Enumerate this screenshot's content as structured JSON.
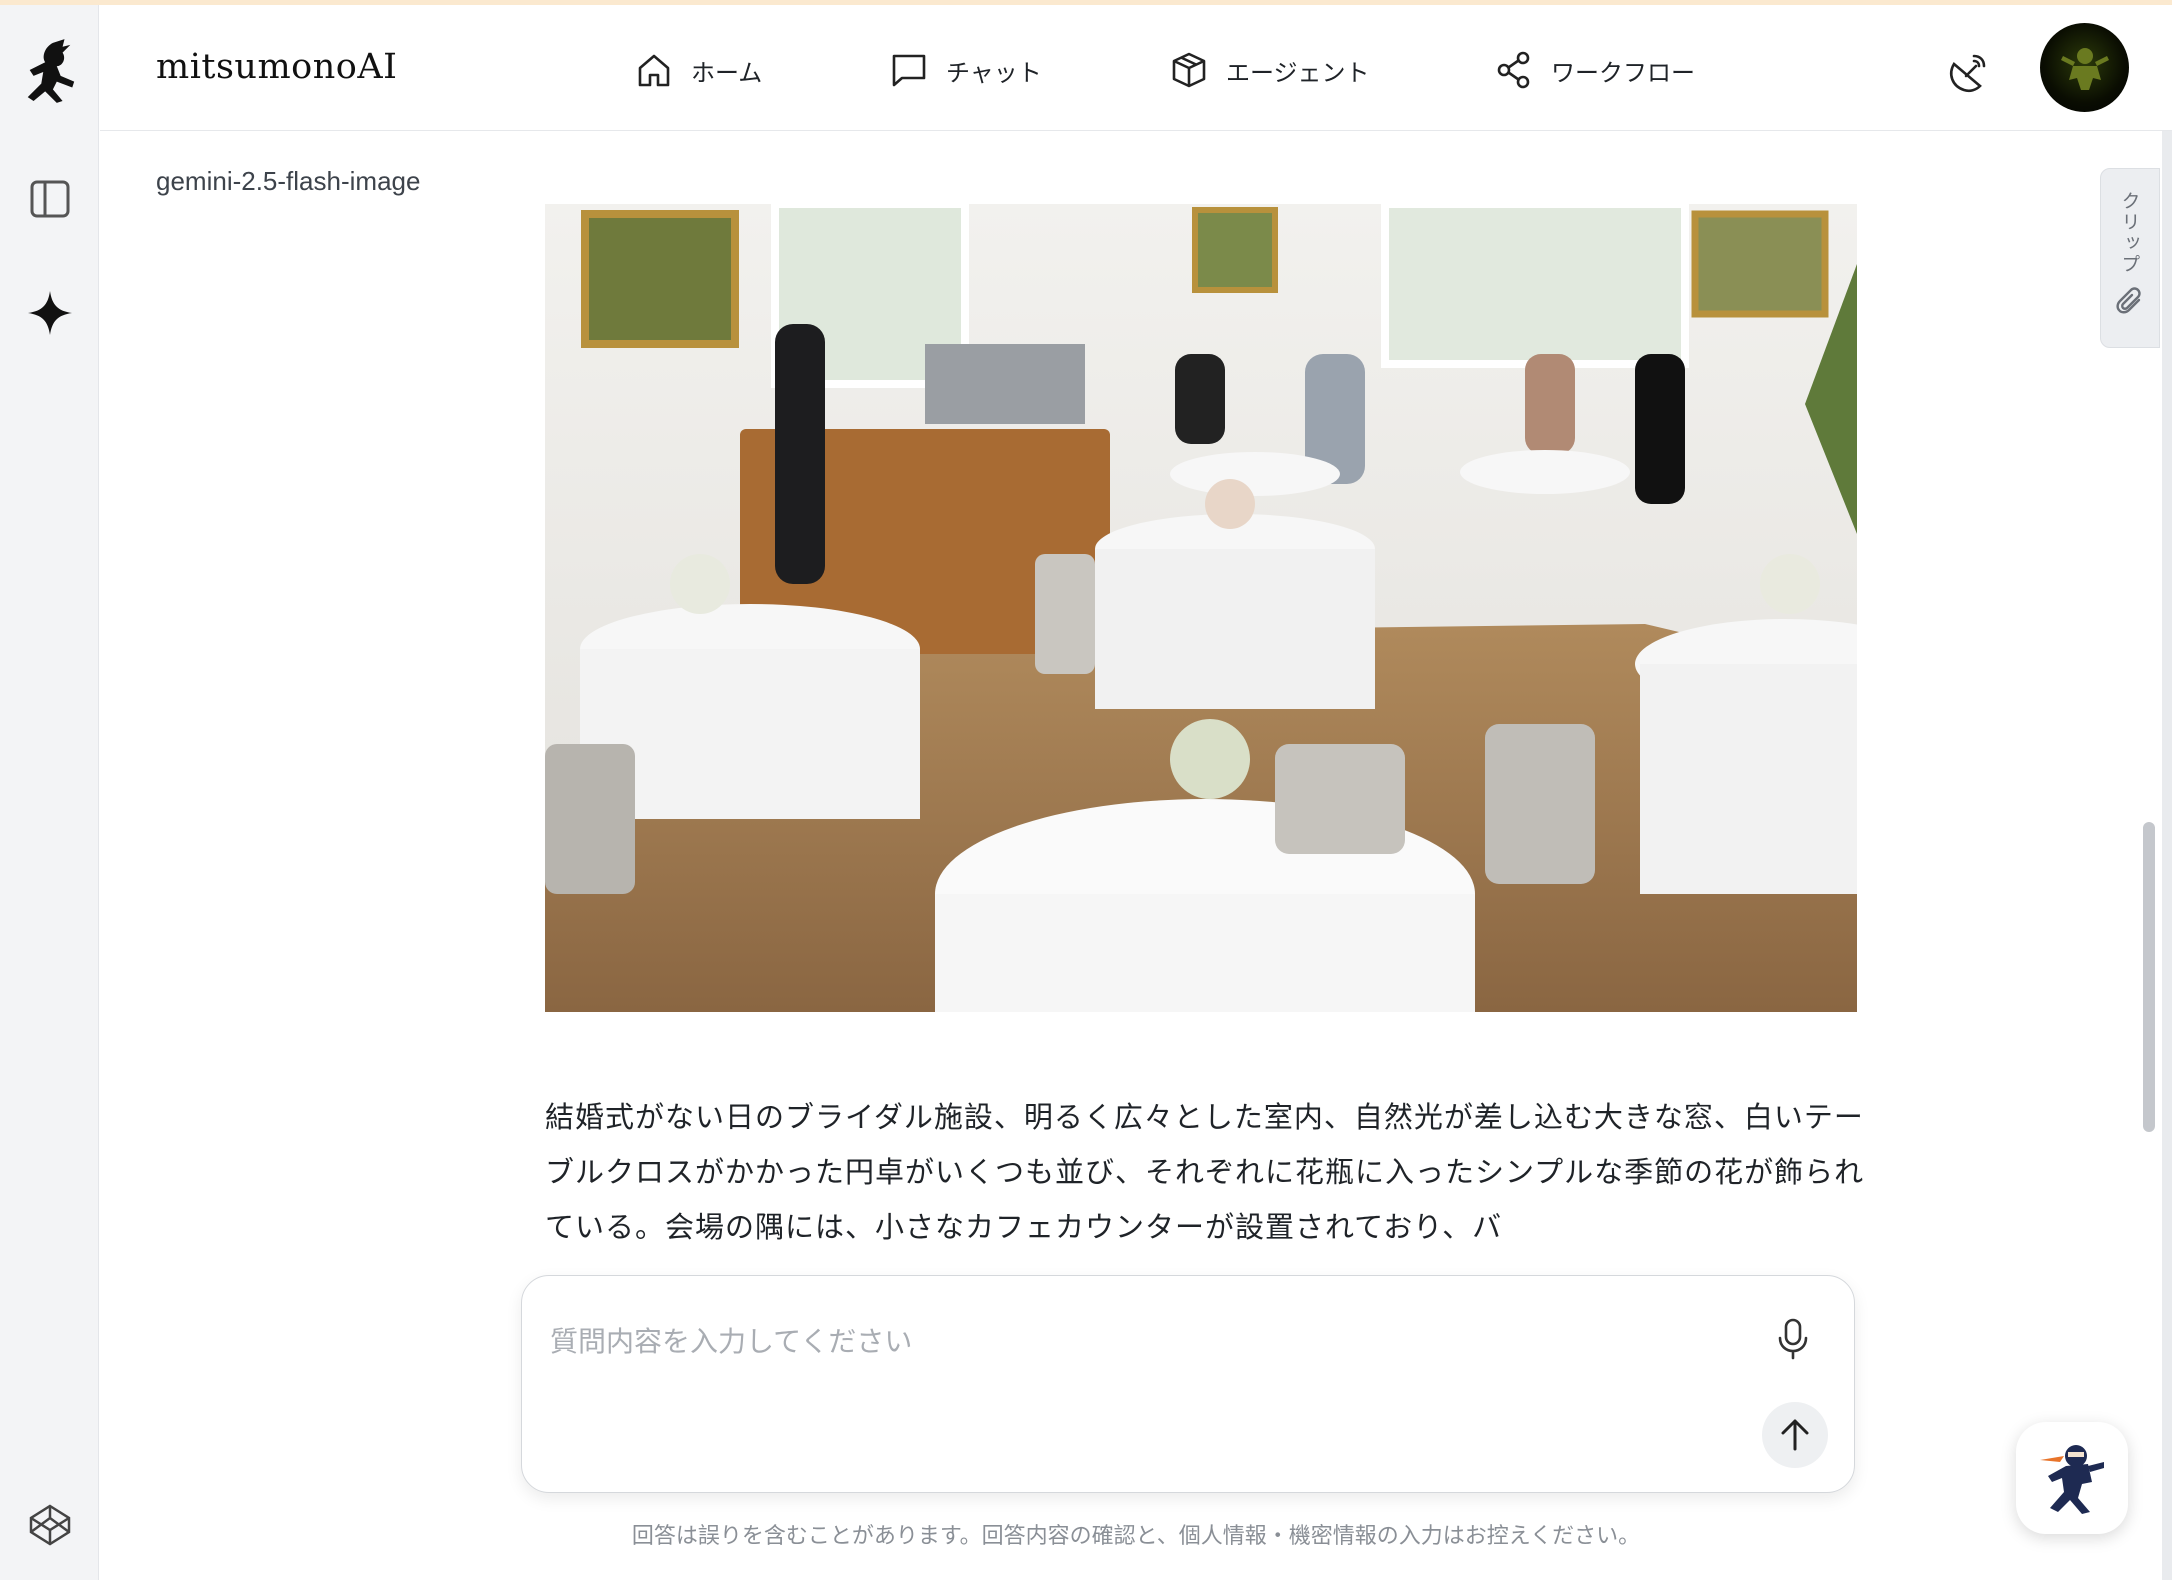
{
  "app": {
    "brand": "mitsumonoAI"
  },
  "nav": [
    {
      "label": "ホーム",
      "icon": "home-icon"
    },
    {
      "label": "チャット",
      "icon": "chat-icon"
    },
    {
      "label": "エージェント",
      "icon": "cube-icon"
    },
    {
      "label": "ワークフロー",
      "icon": "share-nodes-icon"
    }
  ],
  "message": {
    "model": "gemini-2.5-flash-image",
    "image_alt": "generated image of a bright bridal venue with round white-clothed tables, flowers and a small cafe counter",
    "text": "結婚式がない日のブライダル施設、明るく広々とした室内、自然光が差し込む大きな窓、白いテーブルクロスがかかった円卓がいくつも並び、それぞれに花瓶に入ったシンプルな季節の花が飾られている。会場の隅には、小さなカフェカウンターが設置されており、バ"
  },
  "clip": {
    "label": "クリップ"
  },
  "input": {
    "placeholder": "質問内容を入力してください"
  },
  "disclaimer": "回答は誤りを含むことがあります。回答内容の確認と、個人情報・機密情報の入力はお控えください。",
  "colors": {
    "accent": "#111111",
    "rail": "#f3f4f6",
    "topline": "#fbe9cf"
  }
}
